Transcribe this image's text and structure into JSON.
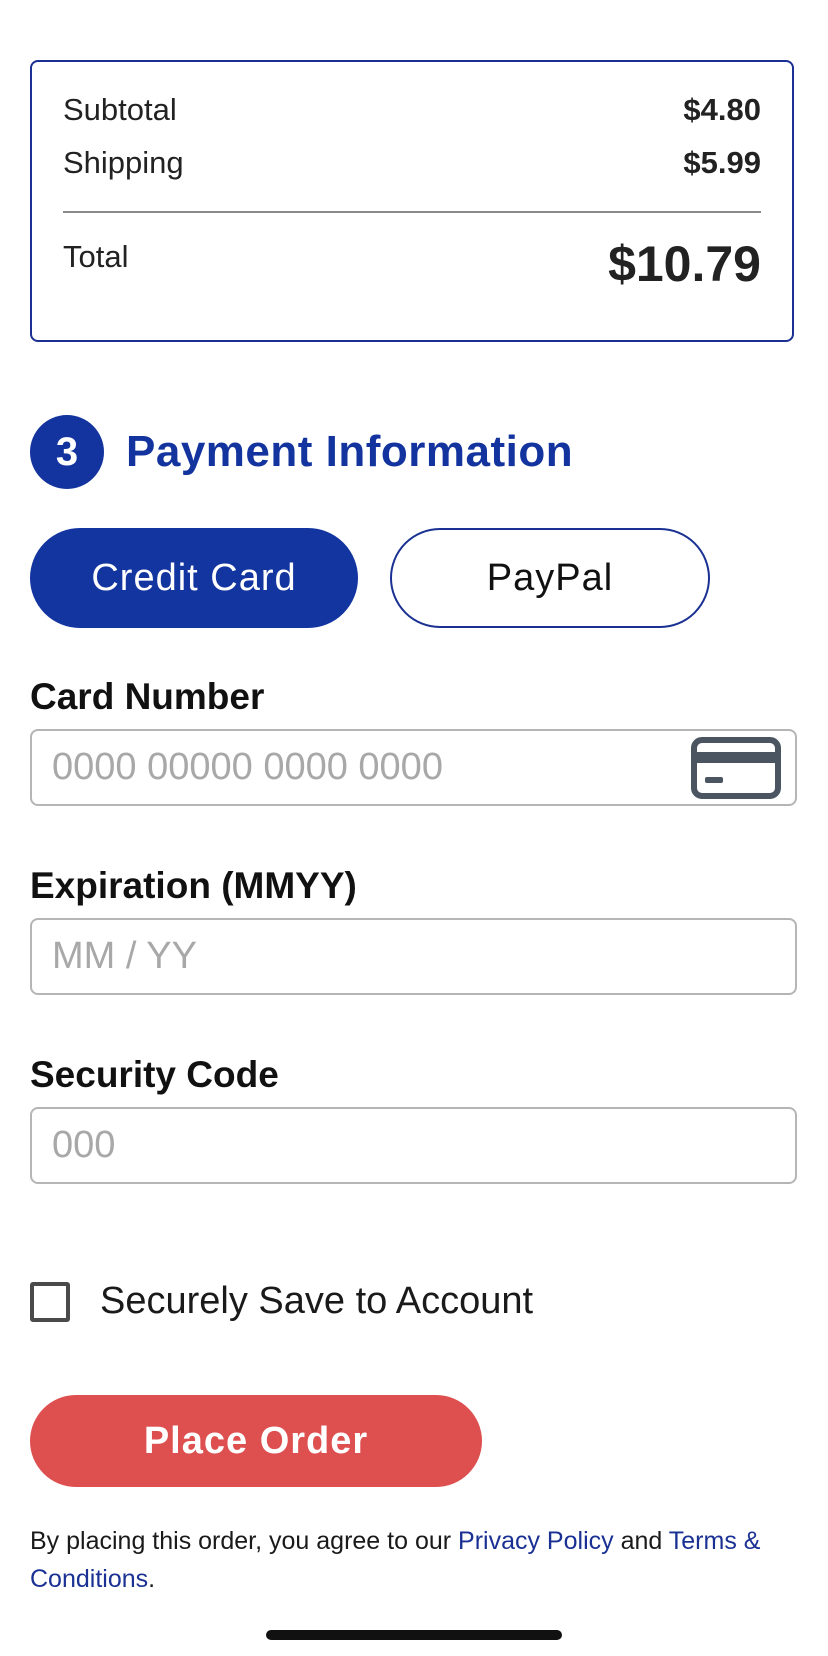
{
  "summary": {
    "subtotal_label": "Subtotal",
    "subtotal_value": "$4.80",
    "shipping_label": "Shipping",
    "shipping_value": "$5.99",
    "total_label": "Total",
    "total_value": "$10.79"
  },
  "payment": {
    "step_number": "3",
    "title": "Payment Information",
    "tabs": [
      {
        "label": "Credit Card",
        "selected": true
      },
      {
        "label": "PayPal",
        "selected": false
      }
    ]
  },
  "fields": {
    "card_number": {
      "label": "Card Number",
      "placeholder": "0000 00000 0000 0000",
      "value": "",
      "icon": "credit-card-icon"
    },
    "expiration": {
      "label": "Expiration (MMYY)",
      "placeholder": "MM / YY",
      "value": ""
    },
    "security_code": {
      "label": "Security Code",
      "placeholder": "000",
      "value": ""
    }
  },
  "save_to_account": {
    "label": "Securely Save to Account",
    "checked": false
  },
  "place_order_label": "Place Order",
  "legal": {
    "prefix": "By placing this order, you agree to our ",
    "privacy_link": "Privacy Policy",
    "and": " and ",
    "terms_link": "Terms & Conditions",
    "suffix": "."
  },
  "colors": {
    "brand_blue": "#13349e",
    "order_red": "#de5050",
    "border_gray": "#b5b5b5"
  }
}
